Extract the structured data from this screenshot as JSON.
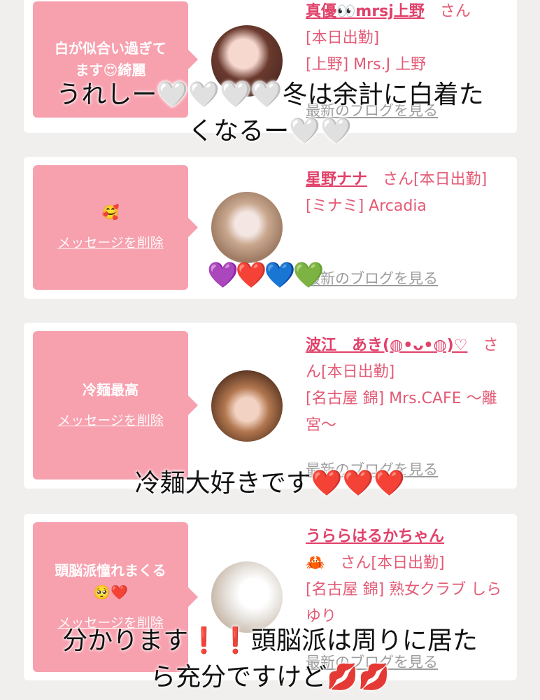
{
  "cards": [
    {
      "message": "白が似合い過ぎて\nます😍綺麗",
      "delete_label": "",
      "name": "真優👀mrsj上野",
      "honorific": "さん",
      "status": "[本日出勤]",
      "shop": "[上野] Mrs.J 上野",
      "blog": "最新のブログを見る"
    },
    {
      "message": "🥰",
      "delete_label": "メッセージを削除",
      "name": "星野ナナ",
      "honorific": "さん[本日出勤]",
      "status": "",
      "shop": "[ミナミ] Arcadia",
      "blog": "最新のブログを見る"
    },
    {
      "message": "冷麺最高",
      "delete_label": "メッセージを削除",
      "name": "波江　あき(◍•ᴗ•◍)♡",
      "honorific": "さん[本日出勤]",
      "status": "",
      "shop": "[名古屋 錦] Mrs.CAFE 〜離宮〜",
      "blog": "最新のブログを見る"
    },
    {
      "message": "頭脳派憧れまくる\n🥺❤️",
      "delete_label": "メッセージを削除",
      "name": "うららはるかちゃん",
      "name_emoji": "🦀",
      "honorific": "さん[本日出勤]",
      "status": "",
      "shop": "[名古屋 錦] 熟女クラブ しらゆり",
      "blog": "最新のブログを見る"
    }
  ],
  "overlays": {
    "top": "うれしー🤍🤍🤍🤍冬は余計に白着た\nくなるー🤍🤍",
    "hearts": "💜❤️💙💚",
    "middle": "冷麺大好きです❤️❤️❤️",
    "bottom": "分かります❗️❗️頭脳派は周りに居た\nら充分ですけど💋💋"
  },
  "colors": {
    "bubble": "#f7a0ae",
    "accent": "#e0416a",
    "background": "#f0efee"
  }
}
